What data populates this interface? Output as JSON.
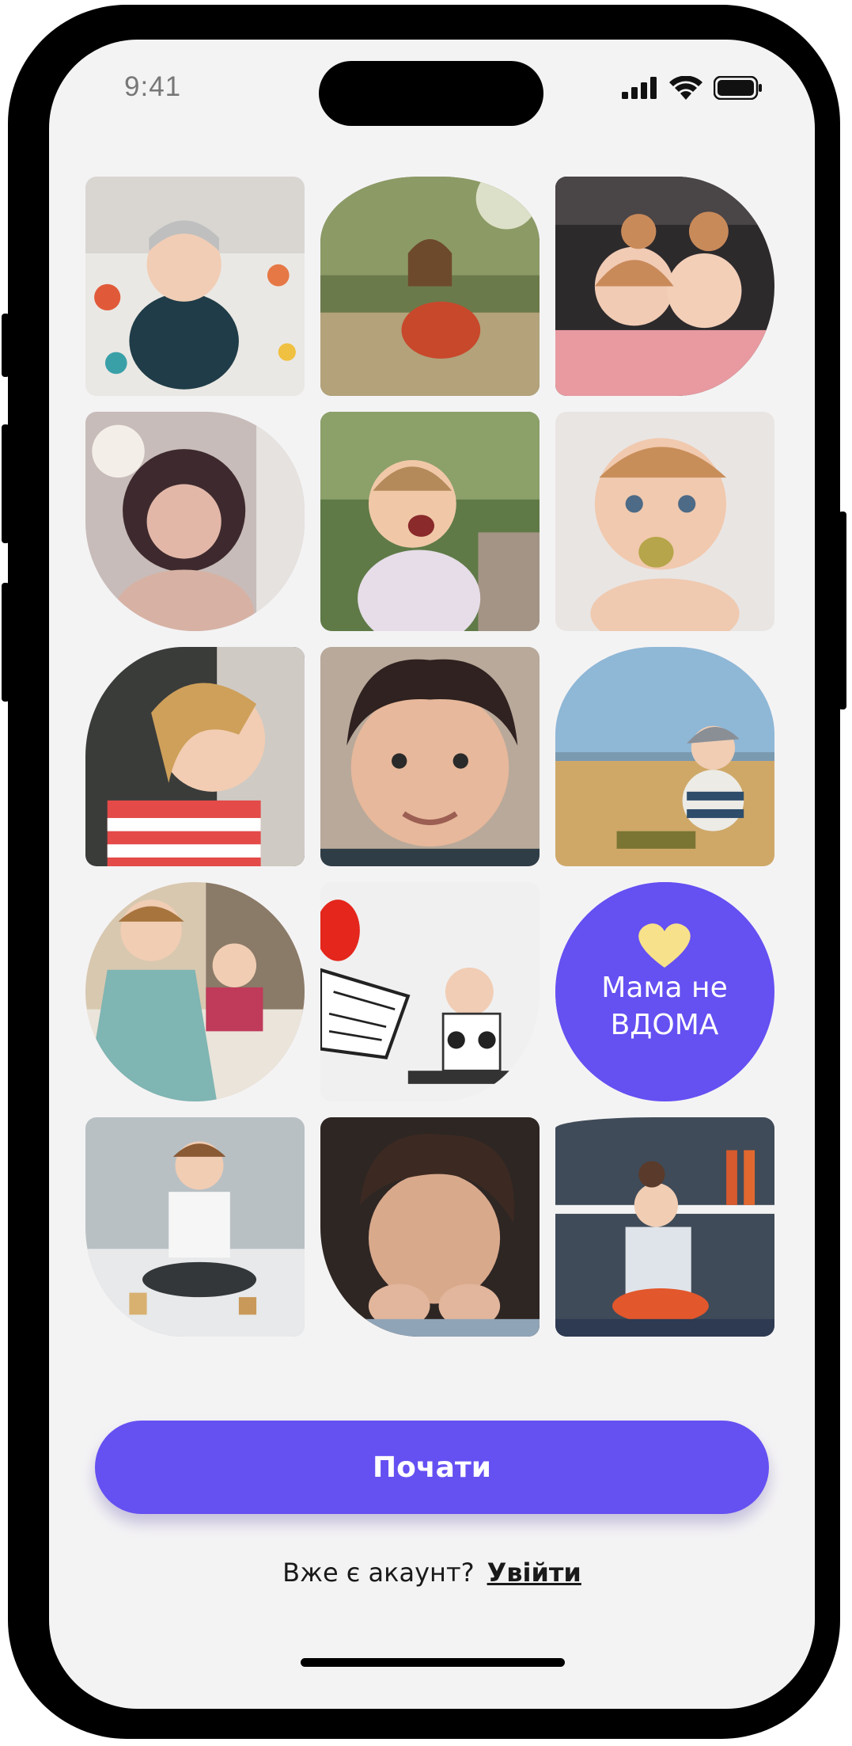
{
  "status_bar": {
    "time": "9:41"
  },
  "photo_grid": {
    "logo": {
      "line1": "Мама не",
      "line2": "вдома"
    }
  },
  "actions": {
    "start_label": "Почати",
    "account_prompt": "Вже є акаунт?",
    "login_label": "Увійти"
  },
  "colors": {
    "accent": "#6550f2",
    "logo_heart": "#f7e18a",
    "screen_bg": "#f4f3f4"
  }
}
